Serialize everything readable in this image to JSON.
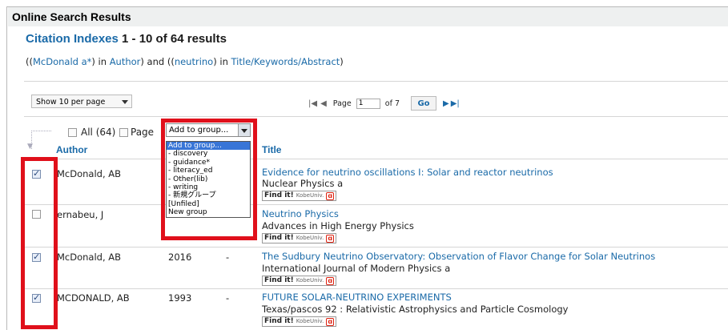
{
  "header": {
    "title": "Online Search Results"
  },
  "citation": {
    "label": "Citation Indexes",
    "range": "1 - 10 of 64 results"
  },
  "query": {
    "p1": "((",
    "author_term": "McDonald a*",
    "p2": ") in ",
    "author_field": "Author",
    "p3": ") and ((",
    "title_term": "neutrino",
    "p4": ") in ",
    "title_field": "Title/Keywords/Abstract",
    "p5": ")"
  },
  "toolbar": {
    "per_page": "Show 10 per page",
    "first_icon": "first-page-icon",
    "prev_icon": "prev-page-icon",
    "page_label": "Page",
    "page_value": "1",
    "of_label": "of 7",
    "go_label": "Go",
    "next_icon": "next-page-icon",
    "last_icon": "last-page-icon"
  },
  "selection": {
    "all_label": "All (64)",
    "page_label": "Page",
    "add_group": "Add to group...",
    "options": [
      "Add to group...",
      "- discovery",
      "- guidance*",
      "- literacy_ed",
      "- Other(lib)",
      "- writing",
      "- 新規グループ",
      "[Unfiled]",
      "New group"
    ]
  },
  "columns": {
    "author": "Author",
    "title": "Title"
  },
  "rows": [
    {
      "checked": true,
      "author": "McDonald, AB",
      "year": "",
      "dash": "",
      "title": "Evidence for neutrino oscillations I: Solar and reactor neutrinos",
      "journal": "Nuclear Physics a"
    },
    {
      "checked": false,
      "author": "ernabeu, J",
      "year": "",
      "dash": "",
      "title": "Neutrino Physics",
      "journal": "Advances in High Energy Physics"
    },
    {
      "checked": true,
      "author": "McDonald, AB",
      "year": "2016",
      "dash": "-",
      "title": "The Sudbury Neutrino Observatory: Observation of Flavor Change for Solar Neutrinos",
      "journal": "International Journal of Modern Physics a"
    },
    {
      "checked": true,
      "author": "MCDONALD, AB",
      "year": "1993",
      "dash": "-",
      "title": "FUTURE SOLAR-NEUTRINO EXPERIMENTS",
      "journal": "Texas/pascos 92 : Relativistic Astrophysics and Particle Cosmology"
    }
  ],
  "findit": {
    "label": "Find it!",
    "sub": "KobeUniv."
  },
  "colors": {
    "link": "#1a6aa8",
    "highlight": "#e0101b",
    "selected_option": "#3875d7"
  }
}
